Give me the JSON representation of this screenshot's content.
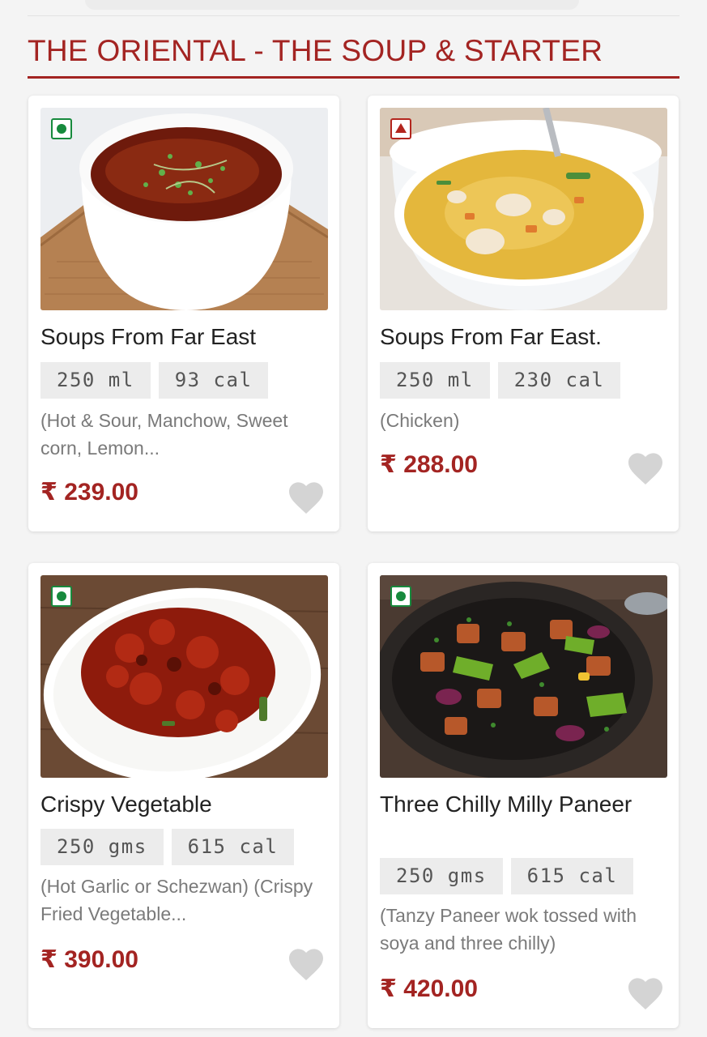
{
  "section": {
    "title": "THE ORIENTAL - THE SOUP & STARTER"
  },
  "items": [
    {
      "name": "Soups From Far East",
      "diet": "veg",
      "quantity": "250 ml",
      "calories": "93 cal",
      "description": "(Hot & Sour, Manchow, Sweet corn, Lemon...",
      "price": "₹ 239.00",
      "photo": "hot-and-sour-soup-photo"
    },
    {
      "name": "Soups From Far East.",
      "diet": "non-veg",
      "quantity": "250 ml",
      "calories": "230 cal",
      "description": "(Chicken)",
      "price": "₹ 288.00",
      "photo": "chicken-soup-photo"
    },
    {
      "name": "Crispy Vegetable",
      "diet": "veg",
      "quantity": "250 gms",
      "calories": "615 cal",
      "description": "(Hot Garlic or Schezwan) (Crispy Fried Vegetable...",
      "price": "₹ 390.00",
      "photo": "crispy-vegetable-photo"
    },
    {
      "name": "Three Chilly Milly Paneer",
      "diet": "veg",
      "quantity": "250 gms",
      "calories": "615 cal",
      "description": "(Tanzy Paneer wok tossed with soya and three chilly)",
      "price": "₹ 420.00",
      "photo": "chilli-paneer-photo"
    }
  ],
  "colors": {
    "accent": "#a32422",
    "veg": "#178a3d",
    "non_veg": "#b3261e",
    "favorite_icon": "#d4d4d4"
  },
  "icons": {
    "veg": "veg-indicator-icon",
    "non_veg": "non-veg-indicator-icon",
    "favorite": "heart-icon"
  }
}
